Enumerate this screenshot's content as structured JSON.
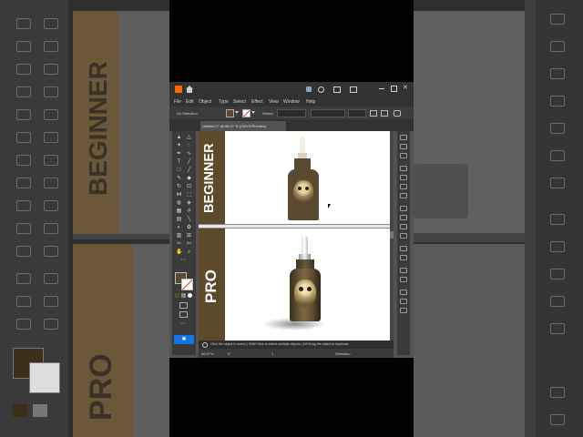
{
  "app": {
    "menu": [
      "File",
      "Edit",
      "Object",
      "Type",
      "Select",
      "Effect",
      "View",
      "Window",
      "Help"
    ],
    "control_bar": {
      "selection": "No Selection",
      "stroke_label": "Stroke:"
    },
    "doc_tab": "Untitled-1* @ 66.67 % (CMYK/Preview)",
    "zoom": "66.67%",
    "rotation": "0°",
    "page_nav": "1",
    "status_selection": "Selection",
    "hint_bar": "Click the object to select  |  Shift+Click to select multiple objects  |  Alt+Drag the object to duplicate"
  },
  "artboards": {
    "top_label": "BEGINNER",
    "bottom_label": "PRO"
  },
  "background": {
    "top_label": "BEGINNER",
    "bottom_label": "PRO"
  },
  "colors": {
    "brand_brown": "#5c4a2c",
    "bottle_brown": "#5a4a30",
    "ui_dark": "#323232",
    "ui_mid": "#535353",
    "accent_blue": "#1473e6"
  },
  "icons": [
    "selection-tool-icon",
    "direct-selection-icon",
    "pen-icon",
    "type-icon",
    "line-icon",
    "rectangle-icon",
    "brush-icon",
    "pencil-icon",
    "eraser-icon",
    "rotate-icon",
    "scale-icon",
    "width-icon",
    "free-transform-icon",
    "shape-builder-icon",
    "perspective-icon",
    "mesh-icon",
    "gradient-icon",
    "eyedropper-icon",
    "blend-icon",
    "symbol-icon",
    "graph-icon",
    "artboard-icon",
    "slice-icon",
    "hand-icon",
    "zoom-icon",
    "fill-swatch",
    "stroke-swatch"
  ]
}
